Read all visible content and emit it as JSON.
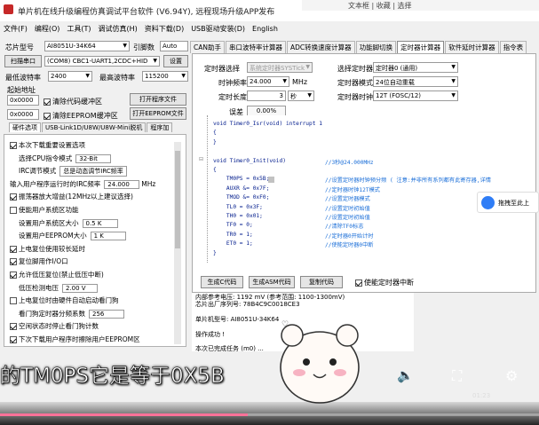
{
  "window": {
    "title": "单片机在线升级编程仿真调试平台软件 (V6.94Y), 远程现场升级APP发布",
    "bg_text": "文本框  | 收藏  | 选择"
  },
  "menu": [
    "文件(F)",
    "编程(O)",
    "工具(T)",
    "调试仿真(H)",
    "资料下载(D)",
    "USB驱动安装(D)",
    "English"
  ],
  "left": {
    "chip_label": "芯片型号",
    "chip_value": "AI8051U-34K64",
    "pin_label": "引脚数",
    "pin_value": "Auto",
    "scan_button": "扫描串口",
    "port_value": "(COM8) CBC1-UART1,2CDC+HID",
    "settings_button": "设置",
    "min_baud_label": "最低波特率",
    "min_baud_value": "2400",
    "max_baud_label": "最高波特率",
    "max_baud_value": "115200",
    "start_addr_label": "起始地址",
    "addr1": "0x0000",
    "clear_code": "清除代码缓冲区",
    "open_program": "打开程序文件",
    "addr2": "0x0000",
    "clear_eeprom": "清除EEPROM缓冲区",
    "open_eeprom": "打开EEPROM文件",
    "hw_tabs": [
      "硬件选项",
      "USB-Link1D/U8W/U8W-Mini脱机",
      "程序加"
    ],
    "opts": [
      {
        "text": "本次下载重要设置选项",
        "on": true
      },
      {
        "text": "选择CPU指令模式",
        "value": "32-Bit",
        "indent": true
      },
      {
        "text": "IRC调节模式",
        "value": "总是动态调节IRC频率",
        "indent": true
      },
      {
        "text": "输入用户程序运行时的IRC频率",
        "value": "24.000",
        "unit": "MHz"
      },
      {
        "text": "振荡器放大增益(12MHz以上建议选择)",
        "on": true
      },
      {
        "text": "使能用户系统区功能",
        "on": false
      },
      {
        "text": "设置用户系统区大小",
        "value": "0.5 K",
        "indent": true
      },
      {
        "text": "设置用户EEPROM大小",
        "value": "1 K",
        "indent": true
      },
      {
        "text": "上电复位使用较长延时",
        "on": true
      },
      {
        "text": "复位脚用作I/O口",
        "on": true
      },
      {
        "text": "允许低压复位(禁止低压中断)",
        "on": true
      },
      {
        "text": "低压检测电压",
        "value": "2.00 V",
        "indent": true
      },
      {
        "text": "上电复位时由硬件自动启动看门狗",
        "on": false
      },
      {
        "text": "看门狗定时器分频系数",
        "value": "256",
        "indent": true
      },
      {
        "text": "空闲状态时停止看门狗计数",
        "on": true
      },
      {
        "text": "下次下载用户程序时擦除用户EEPROM区",
        "on": true
      }
    ]
  },
  "tabs": [
    "CAN助手",
    "串口波特率计算器",
    "ADC转换速度计算器",
    "功能脚切换",
    "定时器计算器",
    "软件延时计算器",
    "指令表"
  ],
  "active_tab": 4,
  "timer": {
    "timer_select_label": "定时器选择",
    "timer_select_value": "系统定时器SYSTick",
    "mode_select_label": "选择定时器",
    "mode_select_value": "定时器0 (通用)",
    "clock_label": "时钟频率",
    "clock_value": "24.000",
    "clock_unit": "MHz",
    "tmode_label": "定时器模式",
    "tmode_value": "24位自动重载",
    "length_label": "定时长度",
    "length_value": "3",
    "length_unit": "秒",
    "tclk_label": "定时器时钟",
    "tclk_value": "12T (FOSC/12)",
    "err_label": "误差",
    "err_value": "0.00%"
  },
  "code": [
    {
      "c": "void Timer0_Isr(void) interrupt 1",
      "m": ""
    },
    {
      "c": "{",
      "m": ""
    },
    {
      "c": "}",
      "m": ""
    },
    {
      "c": "",
      "m": ""
    },
    {
      "c": "void Timer0_Init(void)",
      "m": "//3秒@24.000MHz"
    },
    {
      "c": "{",
      "m": ""
    },
    {
      "c": "    TM0PS = 0x5B;",
      "m": "//设置定时器时钟预分频 ( 注意:并非所有系列都有此寄存器,详情"
    },
    {
      "c": "    AUXR &= 0x7F;",
      "m": "//定时器时钟12T模式"
    },
    {
      "c": "    TMOD &= 0xF0;",
      "m": "//设置定时器模式"
    },
    {
      "c": "    TL0 = 0x3F;",
      "m": "//设置定时初始值"
    },
    {
      "c": "    TH0 = 0x01;",
      "m": "//设置定时初始值"
    },
    {
      "c": "    TF0 = 0;",
      "m": "//清除TF0标志"
    },
    {
      "c": "    TR0 = 1;",
      "m": "//定时器0开始计时"
    },
    {
      "c": "    ET0 = 1;",
      "m": "//使能定时器0中断"
    },
    {
      "c": "}",
      "m": ""
    }
  ],
  "buttons": {
    "gen_c": "生成C代码",
    "gen_asm": "生成ASM代码",
    "copy": "复制代码",
    "enable_irq": "使能定时器中断"
  },
  "log": [
    "内部参考电压: 1192 mV (参考范围: 1100-1300mV)",
    "芯片出厂序列号: 78B4C9C0018CE3",
    "",
    "单片机型号: AI8051U-34K64",
    "",
    "操作成功 !",
    "",
    "本次已完成任务 (m0) ..."
  ],
  "side_widget": "拖拽至此上",
  "subtitle": "的TM0PS它是等于0X5B",
  "video": {
    "time": "01:23",
    "progress": 0.46
  }
}
